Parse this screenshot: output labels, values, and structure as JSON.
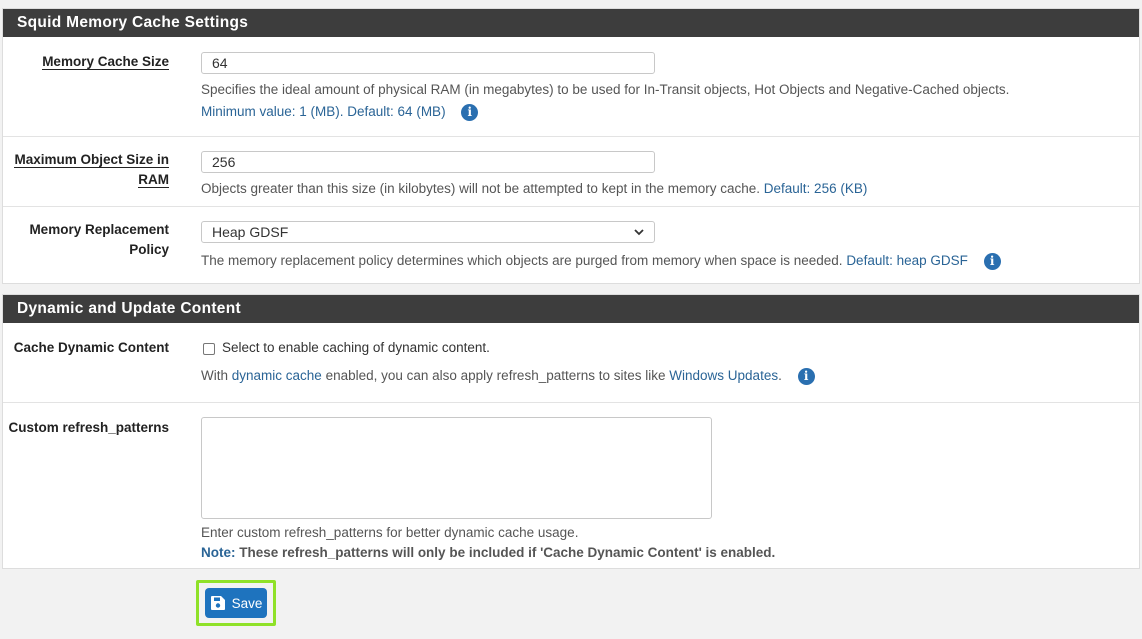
{
  "memory_section": {
    "title": "Squid Memory Cache Settings",
    "memory_cache_size": {
      "label": "Memory Cache Size",
      "value": "64",
      "help": "Specifies the ideal amount of physical RAM (in megabytes) to be used for In-Transit objects, Hot Objects and Negative-Cached objects.",
      "help2": "Minimum value: 1 (MB). Default: 64 (MB)"
    },
    "max_object_size": {
      "label_line1": "Maximum Object Size in",
      "label_line2": "RAM",
      "value": "256",
      "help": "Objects greater than this size (in kilobytes) will not be attempted to kept in the memory cache.",
      "default": "Default: 256 (KB)"
    },
    "replacement_policy": {
      "label_line1": "Memory Replacement",
      "label_line2": "Policy",
      "selected": "Heap GDSF",
      "help": "The memory replacement policy determines which objects are purged from memory when space is needed.",
      "default": "Default: heap GDSF"
    }
  },
  "dynamic_section": {
    "title": "Dynamic and Update Content",
    "cache_dynamic": {
      "label": "Cache Dynamic Content",
      "checkbox_text": "Select to enable caching of dynamic content.",
      "help_prefix": "With ",
      "help_link1": "dynamic cache",
      "help_mid": " enabled, you can also apply refresh_patterns to sites like ",
      "help_link2": "Windows Updates",
      "help_suffix": "."
    },
    "custom_refresh": {
      "label": "Custom refresh_patterns",
      "value": "",
      "help": "Enter custom refresh_patterns for better dynamic cache usage.",
      "note_label": "Note:",
      "note_text": " These refresh_patterns will only be included if 'Cache Dynamic Content' is enabled."
    }
  },
  "save_button": {
    "label": "Save",
    "icon": "floppy-disk-icon"
  },
  "info_icon_glyph": "i",
  "colors": {
    "accent": "#1e73be",
    "heading_bg": "#3d3d3d",
    "highlight": "#8fe128",
    "link": "#2a6496"
  }
}
